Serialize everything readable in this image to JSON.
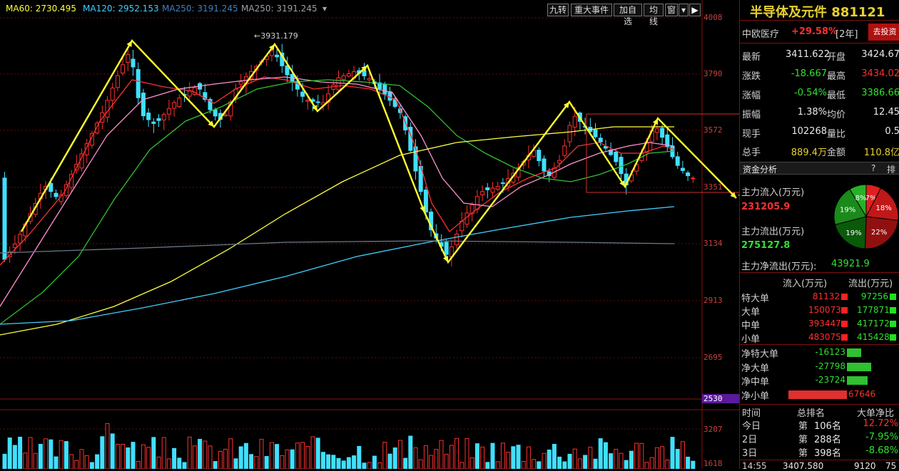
{
  "legend": [
    {
      "label": "MA60: 2730.495",
      "color": "#ffff40"
    },
    {
      "label": "MA120: 2952.153",
      "color": "#40d0ff"
    },
    {
      "label": "MA250: 3191.245",
      "color": "#4080c0"
    },
    {
      "label": "MA250: 3191.245",
      "color": "#9aa0a8"
    }
  ],
  "toolbar": {
    "nine_turn": "九转",
    "events": "重大事件",
    "add_watch": "加自选",
    "trendline": "均线",
    "window": "窗",
    "menu_arrow": "▾"
  },
  "chart_data": {
    "type": "candlestick",
    "y_ticks": [
      "4008",
      "3790",
      "3572",
      "3351",
      "3134",
      "2913",
      "2695",
      "2530"
    ],
    "vol_ticks": [
      "3207",
      "1618"
    ],
    "annotation": "←3931.179"
  },
  "panel": {
    "title": "半导体及元件 881121",
    "related_name": "中欧医疗",
    "related_change": "+29.58%",
    "related_period": "[2年]",
    "invest_btn": "去投资",
    "quote": {
      "latest_label": "最新",
      "latest": "3411.622",
      "open_label": "开盘",
      "open": "3424.67",
      "change_label": "涨跌",
      "change": "-18.667",
      "high_label": "最高",
      "high": "3434.02",
      "pct_label": "涨幅",
      "pct": "-0.54%",
      "low_label": "最低",
      "low": "3386.66",
      "amp_label": "振幅",
      "amp": "1.38%",
      "avg_label": "均价",
      "avg": "12.45",
      "hand_label": "现手",
      "hand": "102268",
      "vr_label": "量比",
      "vr": "0.5",
      "total_label": "总手",
      "total": "889.4万",
      "amount_label": "金额",
      "amount": "110.8亿"
    },
    "fund_tab": "资金分析",
    "help": "?",
    "rank_tab": "排",
    "main_in_label": "主力流入(万元)",
    "main_in": "231205.9",
    "main_out_label": "主力流出(万元)",
    "main_out": "275127.8",
    "net_label": "主力净流出(万元):",
    "net": "43921.9",
    "pie": [
      {
        "label": "7%",
        "value": 7,
        "color": "#e02020"
      },
      {
        "label": "18%",
        "value": 18,
        "color": "#c01818"
      },
      {
        "label": "22%",
        "value": 22,
        "color": "#901010"
      },
      {
        "label": "19%",
        "value": 19,
        "color": "#0a5a0a"
      },
      {
        "label": "19%",
        "value": 19,
        "color": "#1a8a1a"
      },
      {
        "label": "8%",
        "value": 8,
        "color": "#28b028"
      }
    ],
    "flow_in_header": "流入(万元)",
    "flow_out_header": "流出(万元)",
    "flows": [
      {
        "label": "特大单",
        "in": "81132",
        "out": "97256"
      },
      {
        "label": "大单",
        "in": "150073",
        "out": "177871"
      },
      {
        "label": "中单",
        "in": "393447",
        "out": "417172"
      },
      {
        "label": "小单",
        "in": "483075",
        "out": "415428"
      }
    ],
    "nets": [
      {
        "label": "净特大单",
        "value": "-16123",
        "sign": -1,
        "mag": 16123
      },
      {
        "label": "净大单",
        "value": "-27798",
        "sign": -1,
        "mag": 27798
      },
      {
        "label": "净中单",
        "value": "-23724",
        "sign": -1,
        "mag": 23724
      },
      {
        "label": "净小单",
        "value": "67646",
        "sign": 1,
        "mag": 67646
      }
    ],
    "rank_headers": {
      "time": "时间",
      "rank": "总排名",
      "ratio": "大单净比"
    },
    "ranks": [
      {
        "day": "今日",
        "prefix": "第",
        "pos": "106名",
        "ratio": "12.72%",
        "up": true
      },
      {
        "day": "2日",
        "prefix": "第",
        "pos": "288名",
        "ratio": "-7.95%",
        "up": false
      },
      {
        "day": "3日",
        "prefix": "第",
        "pos": "398名",
        "ratio": "-8.68%",
        "up": false
      }
    ],
    "footer": {
      "time": "14:55",
      "price": "3407.580",
      "vol": "9120",
      "extra": "75"
    }
  }
}
